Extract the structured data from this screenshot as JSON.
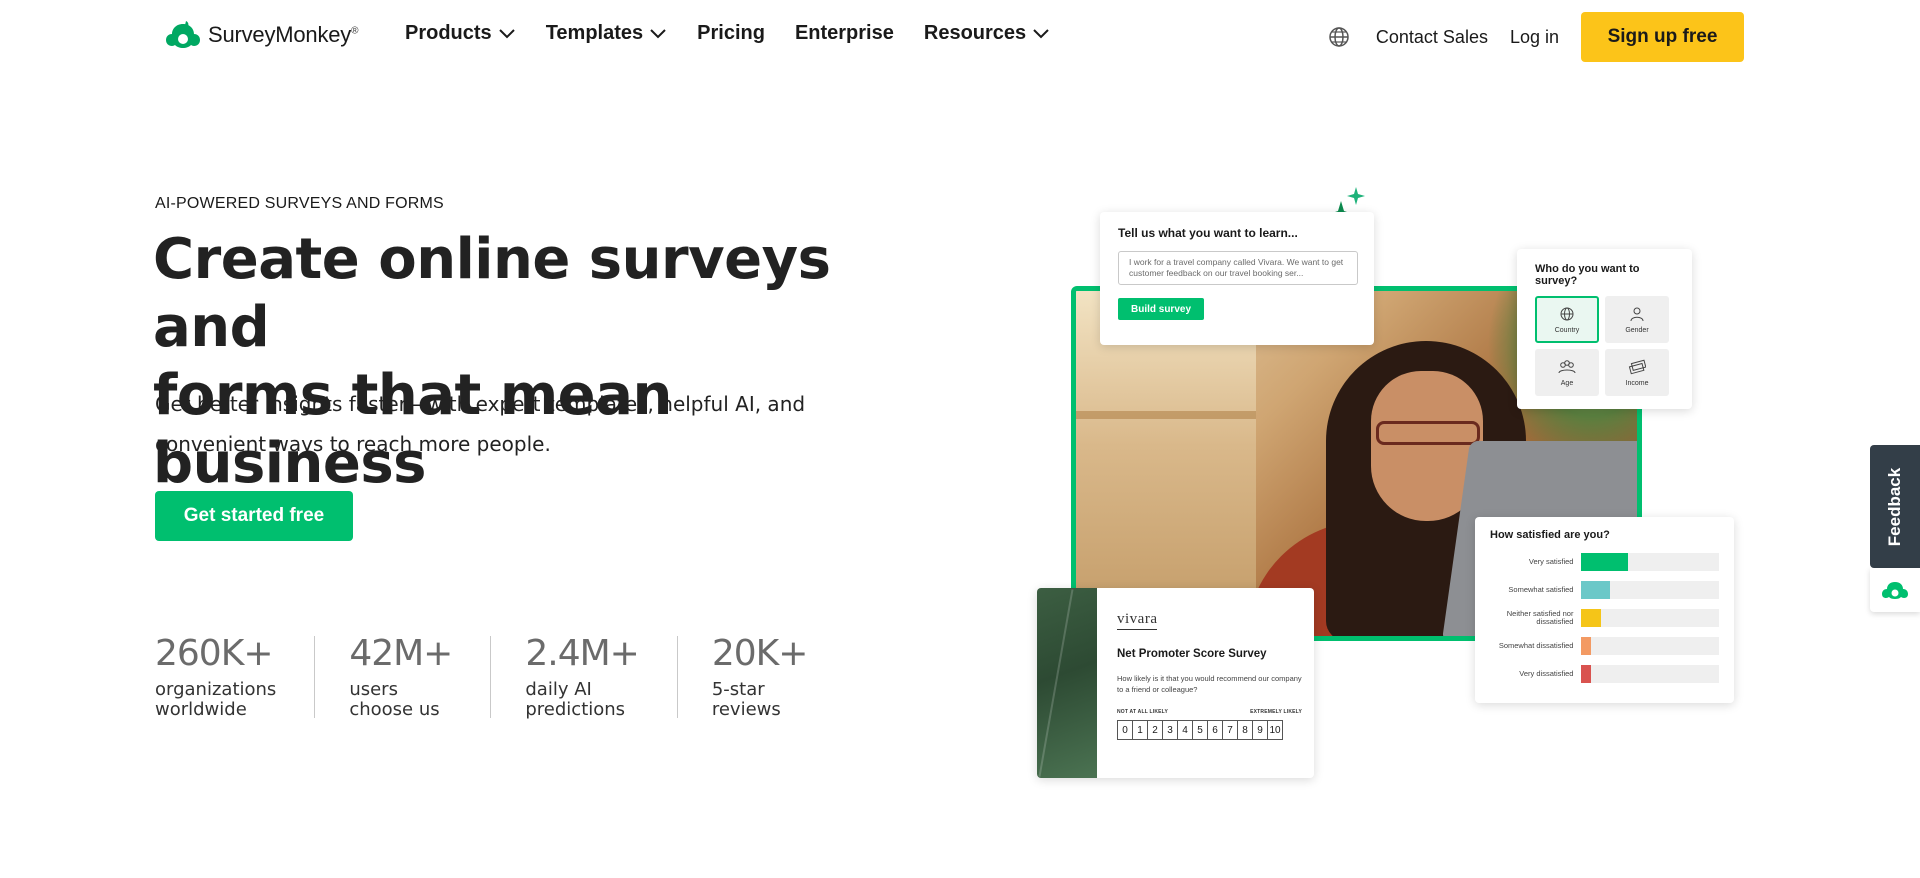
{
  "header": {
    "logo_text": "SurveyMonkey",
    "logo_reg": "®",
    "nav": [
      {
        "label": "Products",
        "dropdown": true
      },
      {
        "label": "Templates",
        "dropdown": true
      },
      {
        "label": "Pricing",
        "dropdown": false
      },
      {
        "label": "Enterprise",
        "dropdown": false
      },
      {
        "label": "Resources",
        "dropdown": true
      }
    ],
    "contact_sales": "Contact Sales",
    "log_in": "Log in",
    "sign_up": "Sign up free"
  },
  "hero": {
    "eyebrow": "AI-POWERED SURVEYS AND FORMS",
    "headline_line1": "Create online surveys and",
    "headline_line2": "forms that mean business",
    "subhead_line1": "Get better insights faster—with expert templates, helpful AI, and",
    "subhead_line2": "convenient ways to reach more people.",
    "cta": "Get started free",
    "stats": [
      {
        "num": "260K+",
        "label1": "organizations",
        "label2": "worldwide"
      },
      {
        "num": "42M+",
        "label1": "users",
        "label2": "choose us"
      },
      {
        "num": "2.4M+",
        "label1": "daily AI",
        "label2": "predictions"
      },
      {
        "num": "20K+",
        "label1": "5-star",
        "label2": "reviews"
      }
    ]
  },
  "illustration": {
    "learn_card": {
      "title": "Tell us what you want to learn...",
      "input_text": "I work for a travel company called Vivara. We want to get customer feedback on our travel booking ser...",
      "button": "Build survey"
    },
    "who_card": {
      "title": "Who do you want to survey?",
      "options": [
        {
          "label": "Country",
          "icon": "globe-icon",
          "active": true
        },
        {
          "label": "Gender",
          "icon": "person-icon",
          "active": false
        },
        {
          "label": "Age",
          "icon": "people-icon",
          "active": false
        },
        {
          "label": "Income",
          "icon": "money-icon",
          "active": false
        }
      ]
    },
    "satisfaction_card": {
      "title": "How satisfied are you?",
      "rows": [
        {
          "label": "Very satisfied",
          "fill": 0.34,
          "color": "#00bf6f"
        },
        {
          "label": "Somewhat satisfied",
          "fill": 0.21,
          "color": "#6bc8c8"
        },
        {
          "label": "Neither satisfied nor dissatisfied",
          "fill": 0.14,
          "color": "#f5c518"
        },
        {
          "label": "Somewhat dissatisfied",
          "fill": 0.07,
          "color": "#f39a63"
        },
        {
          "label": "Very dissatisfied",
          "fill": 0.07,
          "color": "#d9534f"
        }
      ]
    },
    "nps_card": {
      "brand": "vivara",
      "title": "Net Promoter Score Survey",
      "question": "How likely is it that you would recommend our company to a friend or colleague?",
      "low_label": "NOT AT ALL LIKELY",
      "high_label": "EXTREMELY LIKELY",
      "scale": [
        "0",
        "1",
        "2",
        "3",
        "4",
        "5",
        "6",
        "7",
        "8",
        "9",
        "10"
      ]
    }
  },
  "feedback_tab": {
    "label": "Feedback"
  },
  "colors": {
    "brand_green": "#00bf6f",
    "signup_yellow": "#fcc419",
    "feedback_bg": "#333e48"
  }
}
